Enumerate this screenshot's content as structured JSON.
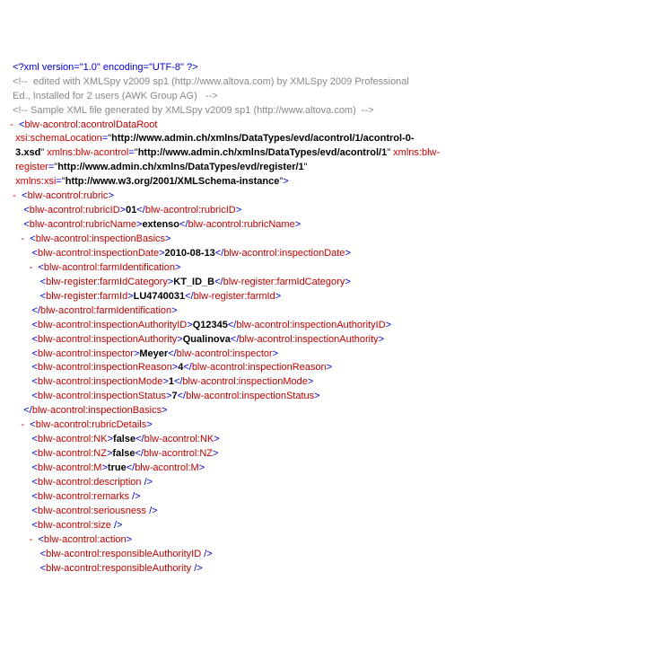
{
  "xmldecl": "<?xml version=\"1.0\" encoding=\"UTF-8\" ?>",
  "comment1": "<!--  edited with XMLSpy v2009 sp1 (http://www.altova.com) by XMLSpy 2009 Professional Ed., Installed for 2 users (AWK Group AG)  -->",
  "comment2": "<!-- Sample XML file generated by XMLSpy v2009 sp1 (http://www.altova.com)  -->",
  "root": {
    "name": "blw-acontrol:acontrolDataRoot",
    "attrs": {
      "schemaLocation_name": "xsi:schemaLocation",
      "schemaLocation_val": "http://www.admin.ch/xmlns/DataTypes/evd/acontrol/1/acontrol-0-3.xsd",
      "ns1_name": "xmlns:blw-acontrol",
      "ns1_val": "http://www.admin.ch/xmlns/DataTypes/evd/acontrol/1",
      "ns2_name": "xmlns:blw-register",
      "ns2_val": "http://www.admin.ch/xmlns/DataTypes/evd/register/1",
      "ns3_name": "xmlns:xsi",
      "ns3_val": "http://www.w3.org/2001/XMLSchema-instance"
    }
  },
  "rubric": "blw-acontrol:rubric",
  "rubricID_tag": "blw-acontrol:rubricID",
  "rubricID_val": "01",
  "rubricName_tag": "blw-acontrol:rubricName",
  "rubricName_val": "extenso",
  "inspectionBasics": "blw-acontrol:inspectionBasics",
  "inspectionDate_tag": "blw-acontrol:inspectionDate",
  "inspectionDate_val": "2010-08-13",
  "farmIdentification": "blw-acontrol:farmIdentification",
  "farmIdCategory_tag": "blw-register:farmIdCategory",
  "farmIdCategory_val": "KT_ID_B",
  "farmId_tag": "blw-register:farmId",
  "farmId_val": "LU4740031",
  "inspectionAuthorityID_tag": "blw-acontrol:inspectionAuthorityID",
  "inspectionAuthorityID_val": "Q12345",
  "inspectionAuthority_tag": "blw-acontrol:inspectionAuthority",
  "inspectionAuthority_val": "Qualinova",
  "inspector_tag": "blw-acontrol:inspector",
  "inspector_val": "Meyer",
  "inspectionReason_tag": "blw-acontrol:inspectionReason",
  "inspectionReason_val": "4",
  "inspectionMode_tag": "blw-acontrol:inspectionMode",
  "inspectionMode_val": "1",
  "inspectionStatus_tag": "blw-acontrol:inspectionStatus",
  "inspectionStatus_val": "7",
  "rubricDetails": "blw-acontrol:rubricDetails",
  "NK_tag": "blw-acontrol:NK",
  "NK_val": "false",
  "NZ_tag": "blw-acontrol:NZ",
  "NZ_val": "false",
  "M_tag": "blw-acontrol:M",
  "M_val": "true",
  "description_tag": "blw-acontrol:description",
  "remarks_tag": "blw-acontrol:remarks",
  "seriousness_tag": "blw-acontrol:seriousness",
  "size_tag": "blw-acontrol:size",
  "action_tag": "blw-acontrol:action",
  "responsibleAuthorityID_tag": "blw-acontrol:responsibleAuthorityID",
  "responsibleAuthority_tag": "blw-acontrol:responsibleAuthority",
  "toggle": "-"
}
